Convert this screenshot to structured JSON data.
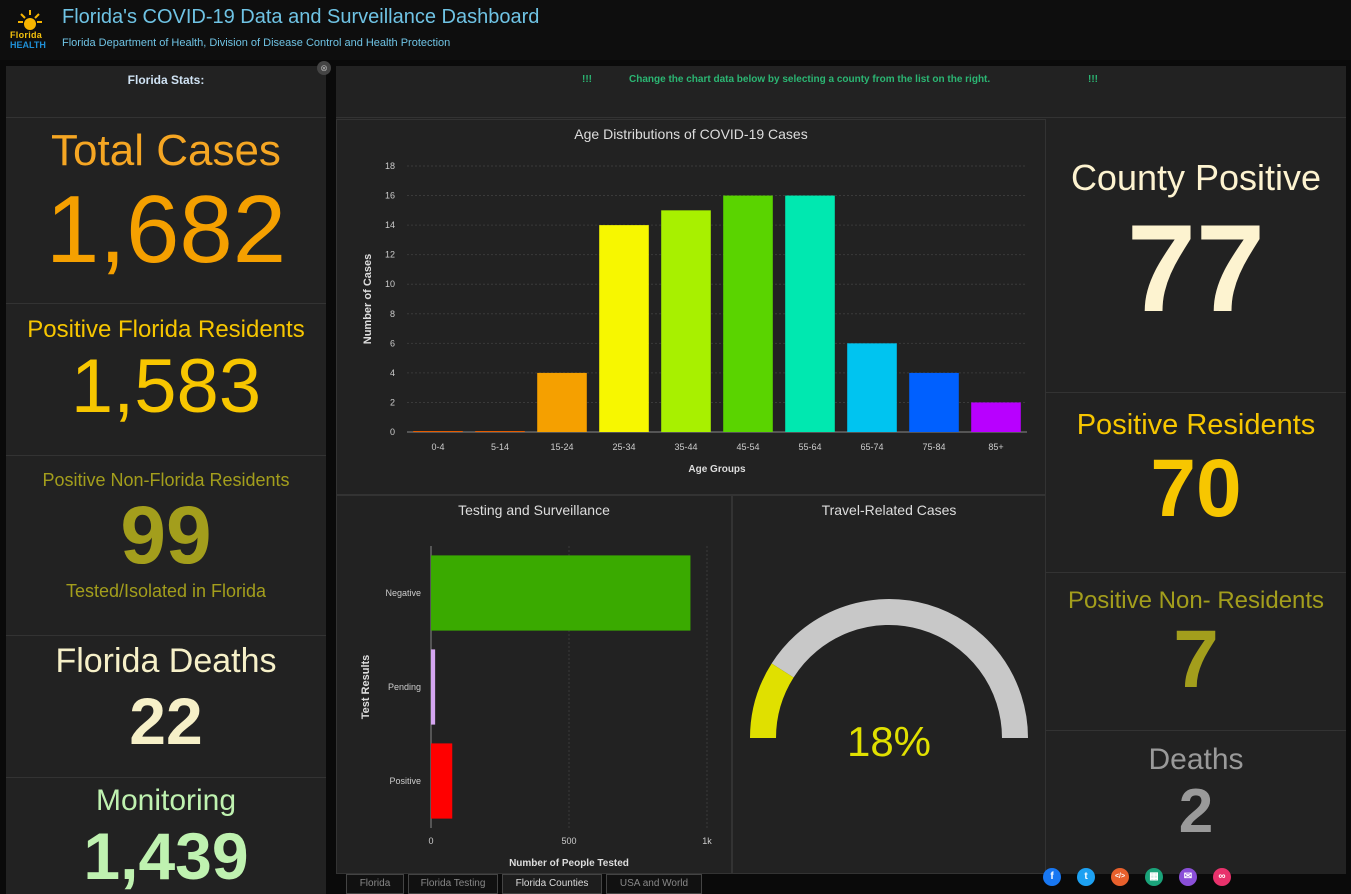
{
  "header": {
    "title": "Florida's COVID-19 Data and Surveillance Dashboard",
    "subtitle": "Florida Department of Health, Division of Disease Control and Health Protection",
    "logo_text_top": "Florida",
    "logo_text_bottom": "HEALTH"
  },
  "left_panel": {
    "title": "Florida Stats:",
    "total_cases_label": "Total Cases",
    "total_cases_value": "1,682",
    "positive_residents_label": "Positive Florida Residents",
    "positive_residents_value": "1,583",
    "positive_nonresidents_label": "Positive Non-Florida Residents",
    "positive_nonresidents_value": "99",
    "tested_isolated_label": "Tested/Isolated in Florida",
    "deaths_label": "Florida Deaths",
    "deaths_value": "22",
    "monitoring_label": "Monitoring",
    "monitoring_value": "1,439"
  },
  "notice": {
    "bang": "!!!",
    "message": "Change the chart data below by selecting a county from the list on the right."
  },
  "age_chart": {
    "chart_data": {
      "type": "bar",
      "title": "Age Distributions of COVID-19 Cases",
      "xlabel": "Age Groups",
      "ylabel": "Number of Cases",
      "categories": [
        "0-4",
        "5-14",
        "15-24",
        "25-34",
        "35-44",
        "45-54",
        "55-64",
        "65-74",
        "75-84",
        "85+"
      ],
      "values": [
        0,
        0,
        4,
        14,
        15,
        16,
        16,
        6,
        4,
        2
      ],
      "colors": [
        "#e65c00",
        "#e65c00",
        "#f5a000",
        "#f7f700",
        "#a8f000",
        "#5ad400",
        "#00e8b0",
        "#00c4f0",
        "#0060ff",
        "#b800ff"
      ],
      "ylim": [
        0,
        18
      ],
      "yticks": [
        "0",
        "2",
        "4",
        "6",
        "8",
        "10",
        "12",
        "14",
        "16",
        "18"
      ],
      "grid": true
    }
  },
  "testing_chart": {
    "chart_data": {
      "type": "bar",
      "orientation": "horizontal",
      "title": "Testing and Surveillance",
      "xlabel": "Number of People Tested",
      "ylabel": "Test Results",
      "categories": [
        "Negative",
        "Pending",
        "Positive"
      ],
      "values": [
        940,
        15,
        77
      ],
      "colors": [
        "#3aaa00",
        "#d4a6f0",
        "#ff0000"
      ],
      "xlim": [
        0,
        1000
      ],
      "xticks": [
        "0",
        "500",
        "1k"
      ],
      "grid": true
    }
  },
  "travel_gauge": {
    "title": "Travel-Related Cases",
    "percent_label": "18%",
    "percent": 18,
    "fill_color": "#e0e000",
    "track_color": "#c8c8c8"
  },
  "right_panel": {
    "county_positive_label": "County Positive",
    "county_positive_value": "77",
    "positive_residents_label": "Positive Residents",
    "positive_residents_value": "70",
    "positive_nonresidents_label": "Positive Non- Residents",
    "positive_nonresidents_value": "7",
    "deaths_label": "Deaths",
    "deaths_value": "2"
  },
  "tabs": [
    {
      "label": "Florida"
    },
    {
      "label": "Florida Testing"
    },
    {
      "label": "Florida Counties"
    },
    {
      "label": "USA and World"
    }
  ],
  "social": [
    {
      "icon": "facebook-icon",
      "glyph": "f",
      "color": "#1877f2"
    },
    {
      "icon": "twitter-icon",
      "glyph": "t",
      "color": "#1da1f2"
    },
    {
      "icon": "embed-code-icon",
      "glyph": "</>",
      "color": "#e8602c"
    },
    {
      "icon": "qr-code-icon",
      "glyph": "▦",
      "color": "#1aa37a"
    },
    {
      "icon": "email-icon",
      "glyph": "✉",
      "color": "#8a4fd8"
    },
    {
      "icon": "link-icon",
      "glyph": "∞",
      "color": "#e8326c"
    }
  ],
  "collapse_icon": "⊗"
}
